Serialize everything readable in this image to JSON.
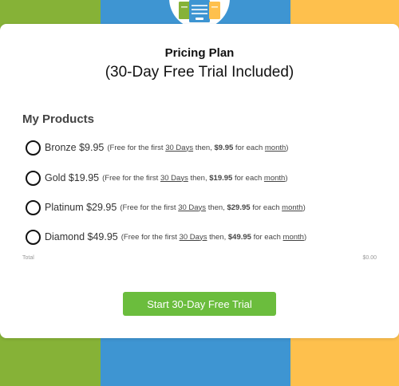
{
  "colors": {
    "bg_left": "#86b237",
    "bg_mid": "#3e95d2",
    "bg_right": "#fec04d",
    "button": "#6bbd3d"
  },
  "logo": {
    "icon": "pricing-logo-icon"
  },
  "header": {
    "title": "Pricing Plan",
    "subtitle": "(30-Day Free Trial Included)"
  },
  "section_title": "My Products",
  "common": {
    "open": "(Free for the first",
    "days": "30 Days",
    "then": "then,",
    "for_each": "for each",
    "month": "month",
    "close": ")"
  },
  "products": [
    {
      "name": "Bronze $9.95",
      "price": "$9.95"
    },
    {
      "name": "Gold $19.95",
      "price": "$19.95"
    },
    {
      "name": "Platinum $29.95",
      "price": "$29.95"
    },
    {
      "name": "Diamond $49.95",
      "price": "$49.95"
    }
  ],
  "total": {
    "label": "Total",
    "value": "$0.00"
  },
  "cta": {
    "label": "Start 30-Day Free Trial"
  }
}
